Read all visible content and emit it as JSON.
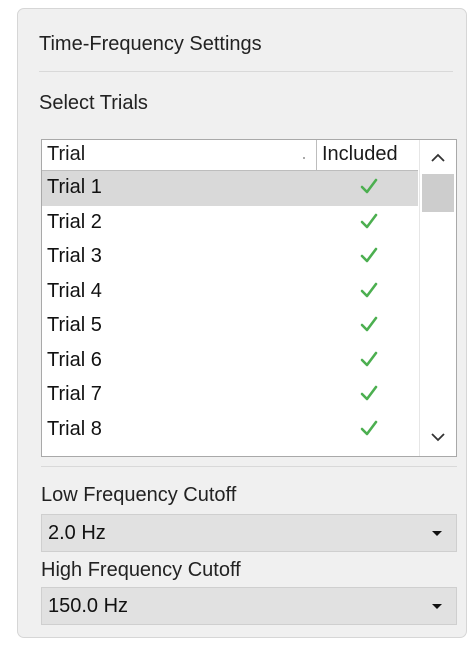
{
  "panel": {
    "title": "Time-Frequency Settings",
    "select_label": "Select Trials"
  },
  "table": {
    "columns": [
      "Trial",
      "Included"
    ],
    "selected_row": 0,
    "check_color": "#4caf50",
    "rows": [
      {
        "name": "Trial 1",
        "included": true
      },
      {
        "name": "Trial 2",
        "included": true
      },
      {
        "name": "Trial 3",
        "included": true
      },
      {
        "name": "Trial 4",
        "included": true
      },
      {
        "name": "Trial 5",
        "included": true
      },
      {
        "name": "Trial 6",
        "included": true
      },
      {
        "name": "Trial 7",
        "included": true
      },
      {
        "name": "Trial 8",
        "included": true
      }
    ]
  },
  "low_cutoff": {
    "label": "Low Frequency Cutoff",
    "value": "2.0 Hz"
  },
  "high_cutoff": {
    "label": "High Frequency Cutoff",
    "value": "150.0 Hz"
  }
}
